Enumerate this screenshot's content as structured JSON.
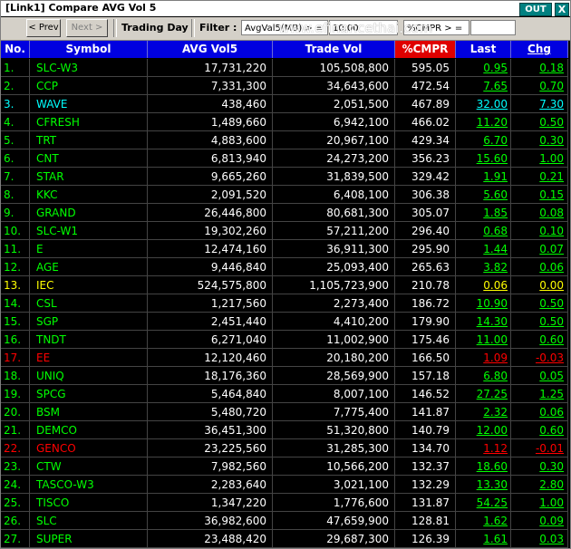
{
  "window": {
    "title": "[Link1] Compare AVG Vol 5",
    "out_label": "OUT",
    "close_label": "X"
  },
  "toolbar": {
    "prev_label": "< Prev",
    "next_label": "Next >",
    "trading_day_label": "Trading Day",
    "filter_label": "Filter :",
    "avgvol_field": "AvgVal5(MB) > =",
    "avgvol_value": "10.00",
    "cmpr_field": "%CMPR > =",
    "cmpr_value": "",
    "watermark": "www.efinancethai.com"
  },
  "colors": {
    "header_bg": "#0000e0",
    "cmpr_header_bg": "#e00000",
    "up": "#00ff00",
    "down": "#ff0000",
    "flat": "#ffff00",
    "volatile": "#00ffff"
  },
  "table": {
    "headers": {
      "no": "No.",
      "symbol": "Symbol",
      "avg_vol5": "AVG Vol5",
      "trade_vol": "Trade Vol",
      "cmpr": "%CMPR",
      "last": "Last",
      "chg": "Chg"
    },
    "rows": [
      {
        "no": "1.",
        "symbol": "SLC-W3",
        "avg": "17,731,220",
        "tv": "105,508,800",
        "cmpr": "595.05",
        "last": "0.95",
        "chg": "0.18",
        "color": "#00ff00"
      },
      {
        "no": "2.",
        "symbol": "CCP",
        "avg": "7,331,300",
        "tv": "34,643,600",
        "cmpr": "472.54",
        "last": "7.65",
        "chg": "0.70",
        "color": "#00ff00"
      },
      {
        "no": "3.",
        "symbol": "WAVE",
        "avg": "438,460",
        "tv": "2,051,500",
        "cmpr": "467.89",
        "last": "32.00",
        "chg": "7.30",
        "color": "#00ffff"
      },
      {
        "no": "4.",
        "symbol": "CFRESH",
        "avg": "1,489,660",
        "tv": "6,942,100",
        "cmpr": "466.02",
        "last": "11.20",
        "chg": "0.50",
        "color": "#00ff00"
      },
      {
        "no": "5.",
        "symbol": "TRT",
        "avg": "4,883,600",
        "tv": "20,967,100",
        "cmpr": "429.34",
        "last": "6.70",
        "chg": "0.30",
        "color": "#00ff00"
      },
      {
        "no": "6.",
        "symbol": "CNT",
        "avg": "6,813,940",
        "tv": "24,273,200",
        "cmpr": "356.23",
        "last": "15.60",
        "chg": "1.00",
        "color": "#00ff00"
      },
      {
        "no": "7.",
        "symbol": "STAR",
        "avg": "9,665,260",
        "tv": "31,839,500",
        "cmpr": "329.42",
        "last": "1.91",
        "chg": "0.21",
        "color": "#00ff00"
      },
      {
        "no": "8.",
        "symbol": "KKC",
        "avg": "2,091,520",
        "tv": "6,408,100",
        "cmpr": "306.38",
        "last": "5.60",
        "chg": "0.15",
        "color": "#00ff00"
      },
      {
        "no": "9.",
        "symbol": "GRAND",
        "avg": "26,446,800",
        "tv": "80,681,300",
        "cmpr": "305.07",
        "last": "1.85",
        "chg": "0.08",
        "color": "#00ff00"
      },
      {
        "no": "10.",
        "symbol": "SLC-W1",
        "avg": "19,302,260",
        "tv": "57,211,200",
        "cmpr": "296.40",
        "last": "0.68",
        "chg": "0.10",
        "color": "#00ff00"
      },
      {
        "no": "11.",
        "symbol": "E",
        "avg": "12,474,160",
        "tv": "36,911,300",
        "cmpr": "295.90",
        "last": "1.44",
        "chg": "0.07",
        "color": "#00ff00"
      },
      {
        "no": "12.",
        "symbol": "AGE",
        "avg": "9,446,840",
        "tv": "25,093,400",
        "cmpr": "265.63",
        "last": "3.82",
        "chg": "0.06",
        "color": "#00ff00"
      },
      {
        "no": "13.",
        "symbol": "IEC",
        "avg": "524,575,800",
        "tv": "1,105,723,900",
        "cmpr": "210.78",
        "last": "0.06",
        "chg": "0.00",
        "color": "#ffff00"
      },
      {
        "no": "14.",
        "symbol": "CSL",
        "avg": "1,217,560",
        "tv": "2,273,400",
        "cmpr": "186.72",
        "last": "10.90",
        "chg": "0.50",
        "color": "#00ff00"
      },
      {
        "no": "15.",
        "symbol": "SGP",
        "avg": "2,451,440",
        "tv": "4,410,200",
        "cmpr": "179.90",
        "last": "14.30",
        "chg": "0.50",
        "color": "#00ff00"
      },
      {
        "no": "16.",
        "symbol": "TNDT",
        "avg": "6,271,040",
        "tv": "11,002,900",
        "cmpr": "175.46",
        "last": "11.00",
        "chg": "0.60",
        "color": "#00ff00"
      },
      {
        "no": "17.",
        "symbol": "EE",
        "avg": "12,120,460",
        "tv": "20,180,200",
        "cmpr": "166.50",
        "last": "1.09",
        "chg": "-0.03",
        "color": "#ff0000"
      },
      {
        "no": "18.",
        "symbol": "UNIQ",
        "avg": "18,176,360",
        "tv": "28,569,900",
        "cmpr": "157.18",
        "last": "6.80",
        "chg": "0.05",
        "color": "#00ff00"
      },
      {
        "no": "19.",
        "symbol": "SPCG",
        "avg": "5,464,840",
        "tv": "8,007,100",
        "cmpr": "146.52",
        "last": "27.25",
        "chg": "1.25",
        "color": "#00ff00"
      },
      {
        "no": "20.",
        "symbol": "BSM",
        "avg": "5,480,720",
        "tv": "7,775,400",
        "cmpr": "141.87",
        "last": "2.32",
        "chg": "0.06",
        "color": "#00ff00"
      },
      {
        "no": "21.",
        "symbol": "DEMCO",
        "avg": "36,451,300",
        "tv": "51,320,800",
        "cmpr": "140.79",
        "last": "12.00",
        "chg": "0.60",
        "color": "#00ff00"
      },
      {
        "no": "22.",
        "symbol": "GENCO",
        "avg": "23,225,560",
        "tv": "31,285,300",
        "cmpr": "134.70",
        "last": "1.12",
        "chg": "-0.01",
        "color": "#ff0000"
      },
      {
        "no": "23.",
        "symbol": "CTW",
        "avg": "7,982,560",
        "tv": "10,566,200",
        "cmpr": "132.37",
        "last": "18.60",
        "chg": "0.30",
        "color": "#00ff00"
      },
      {
        "no": "24.",
        "symbol": "TASCO-W3",
        "avg": "2,283,640",
        "tv": "3,021,100",
        "cmpr": "132.29",
        "last": "13.30",
        "chg": "2.80",
        "color": "#00ff00"
      },
      {
        "no": "25.",
        "symbol": "TISCO",
        "avg": "1,347,220",
        "tv": "1,776,600",
        "cmpr": "131.87",
        "last": "54.25",
        "chg": "1.00",
        "color": "#00ff00"
      },
      {
        "no": "26.",
        "symbol": "SLC",
        "avg": "36,982,600",
        "tv": "47,659,900",
        "cmpr": "128.81",
        "last": "1.62",
        "chg": "0.09",
        "color": "#00ff00"
      },
      {
        "no": "27.",
        "symbol": "SUPER",
        "avg": "23,488,420",
        "tv": "29,687,300",
        "cmpr": "126.39",
        "last": "1.61",
        "chg": "0.03",
        "color": "#00ff00"
      }
    ]
  }
}
